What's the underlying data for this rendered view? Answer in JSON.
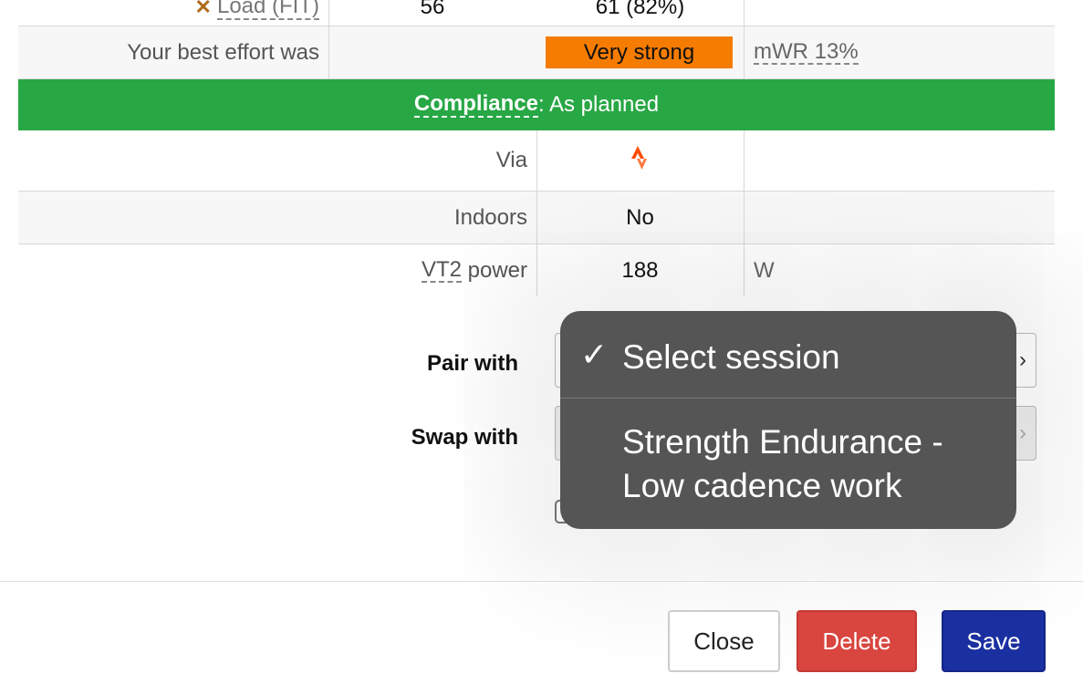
{
  "table": {
    "load_row": {
      "label": "Load (FIT)",
      "planned": "56",
      "actual": "61 (82%)"
    },
    "best_effort": {
      "label": "Your best effort was",
      "badge": "Very strong",
      "mwr": "mWR 13%"
    },
    "compliance": {
      "key": "Compliance",
      "value": ": As planned"
    },
    "via": {
      "label": "Via",
      "icon": "strava-icon"
    },
    "indoors": {
      "label": "Indoors",
      "value": "No"
    },
    "vt2": {
      "label_abbr": "VT2",
      "label_rest": " power",
      "value": "188",
      "unit": "W"
    }
  },
  "form": {
    "pair_label": "Pair with",
    "swap_label": "Swap with"
  },
  "popup": {
    "check": "✓",
    "items": [
      "Select session",
      "Strength Endurance -",
      "Low cadence work"
    ]
  },
  "footer": {
    "close": "Close",
    "delete": "Delete",
    "save": "Save"
  },
  "colors": {
    "compliance_bg": "#28a745",
    "badge_bg": "#f57c00",
    "save_bg": "#1a2fa0",
    "delete_bg": "#d9453f"
  }
}
